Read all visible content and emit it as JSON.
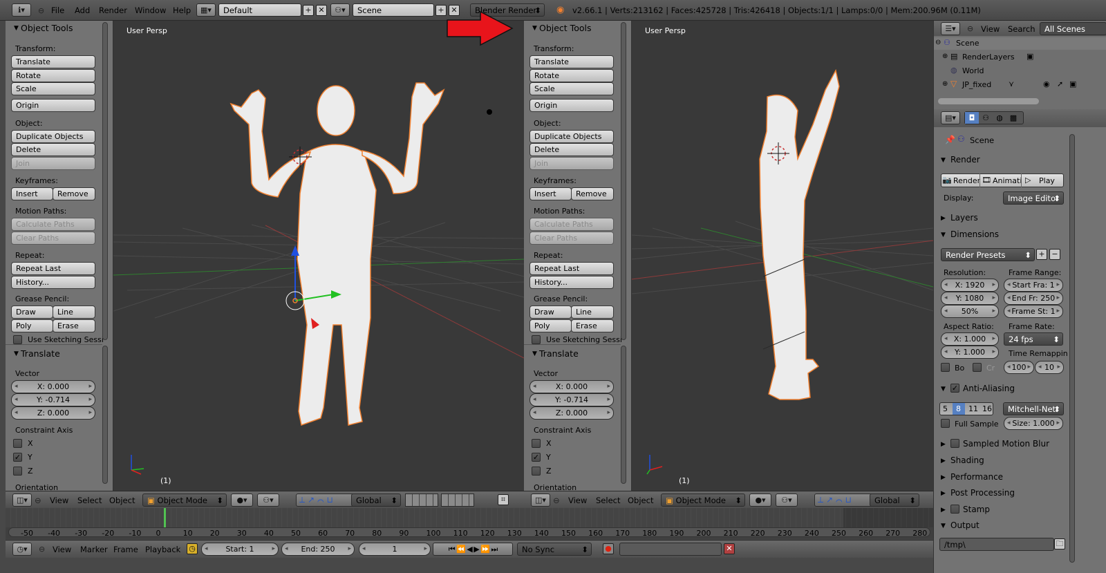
{
  "topbar": {
    "menus": [
      "File",
      "Add",
      "Render",
      "Window",
      "Help"
    ],
    "layout": "Default",
    "scene": "Scene",
    "engine": "Blender Render",
    "stats": "v2.66.1 | Verts:213162 | Faces:425728 | Tris:426418 | Objects:1/1 | Lamps:0/0 | Mem:200.96M (0.11M)"
  },
  "toolshelf": {
    "title": "Object Tools",
    "transform_label": "Transform:",
    "translate": "Translate",
    "rotate": "Rotate",
    "scale": "Scale",
    "origin": "Origin",
    "object_label": "Object:",
    "duplicate": "Duplicate Objects",
    "delete": "Delete",
    "join": "Join",
    "keyframes_label": "Keyframes:",
    "insert": "Insert",
    "remove": "Remove",
    "motion_paths_label": "Motion Paths:",
    "calc_paths": "Calculate Paths",
    "clear_paths": "Clear Paths",
    "repeat_label": "Repeat:",
    "repeat_last": "Repeat Last",
    "history": "History...",
    "grease_label": "Grease Pencil:",
    "draw": "Draw",
    "line": "Line",
    "poly": "Poly",
    "erase": "Erase",
    "sketching": "Use Sketching Sessi",
    "op_title": "Translate",
    "vector_label": "Vector",
    "vx": "X: 0.000",
    "vy": "Y: -0.714",
    "vz": "Z: 0.000",
    "constraint_label": "Constraint Axis",
    "cx": "X",
    "cy": "Y",
    "cz": "Z",
    "orientation_label": "Orientation"
  },
  "viewport": {
    "label": "User Persp",
    "frame": "(1)"
  },
  "viewheader": {
    "view": "View",
    "select": "Select",
    "object": "Object",
    "mode": "Object Mode",
    "orientation": "Global"
  },
  "timeline": {
    "ticks": [
      "-50",
      "-40",
      "-30",
      "-20",
      "-10",
      "0",
      "10",
      "20",
      "30",
      "40",
      "50",
      "60",
      "70",
      "80",
      "90",
      "100",
      "110",
      "120",
      "130",
      "140",
      "150",
      "160",
      "170",
      "180",
      "190",
      "200",
      "210",
      "220",
      "230",
      "240",
      "250",
      "260",
      "270",
      "280"
    ],
    "view": "View",
    "marker": "Marker",
    "frame": "Frame",
    "playback": "Playback",
    "start": "Start: 1",
    "end": "End: 250",
    "current": "1",
    "sync": "No Sync"
  },
  "outliner": {
    "view": "View",
    "search": "Search",
    "filter": "All Scenes",
    "scene": "Scene",
    "renderlayers": "RenderLayers",
    "world": "World",
    "object": "JP_fixed"
  },
  "properties": {
    "scene": "Scene",
    "render_title": "Render",
    "render_btn": "Render",
    "anim_btn": "Animati",
    "play_btn": "Play",
    "display_label": "Display:",
    "display_value": "Image Editor",
    "layers": "Layers",
    "dimensions": "Dimensions",
    "presets": "Render Presets",
    "resolution_label": "Resolution:",
    "res_x": "X: 1920",
    "res_y": "Y: 1080",
    "res_pct": "50%",
    "frame_range_label": "Frame Range:",
    "start_fr": "Start Fra: 1",
    "end_fr": "End Fr: 250",
    "frame_st": "Frame St: 1",
    "aspect_label": "Aspect Ratio:",
    "asp_x": "X: 1.000",
    "asp_y": "Y: 1.000",
    "frame_rate_label": "Frame Rate:",
    "fps": "24 fps",
    "time_remap_label": "Time Remappin",
    "remap_old": "100",
    "remap_new": "10",
    "bo": "Bo",
    "cr": "Cr",
    "anti_aliasing": "Anti-Aliasing",
    "aa_5": "5",
    "aa_8": "8",
    "aa_11": "11",
    "aa_16": "16",
    "filter": "Mitchell-Netr",
    "full_sample": "Full Sample",
    "size": "Size: 1.000",
    "motion_blur": "Sampled Motion Blur",
    "shading": "Shading",
    "performance": "Performance",
    "post_processing": "Post Processing",
    "stamp": "Stamp",
    "output": "Output",
    "output_path": "/tmp\\"
  },
  "colors": {
    "accent_blue": "#5680c2",
    "arrow_red": "#e8141b",
    "selection_orange": "#f08030"
  }
}
